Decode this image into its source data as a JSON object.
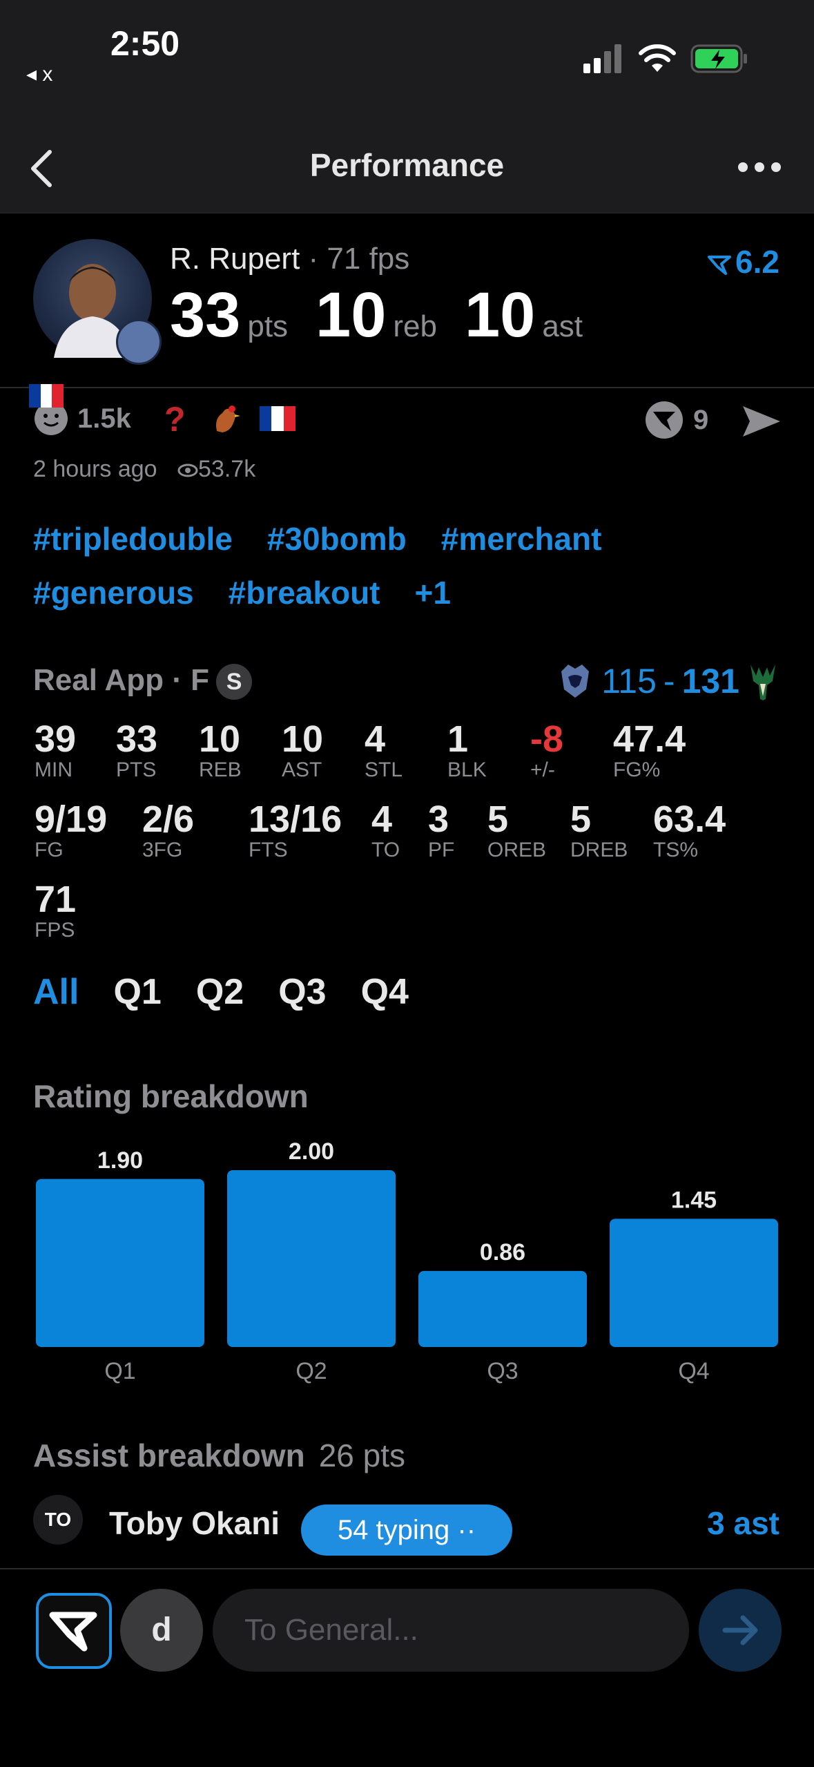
{
  "status": {
    "time": "2:50",
    "back_app": "◂ x"
  },
  "header": {
    "title": "Performance"
  },
  "player": {
    "name": "R. Rupert",
    "fps_label": " · 71 fps",
    "pts": "33",
    "pts_unit": "pts",
    "reb": "10",
    "reb_unit": "reb",
    "ast": "10",
    "ast_unit": "ast",
    "rating": "6.2"
  },
  "social": {
    "likes": "1.5k",
    "comments": "9",
    "time_ago": "2 hours ago",
    "views": "53.7k"
  },
  "tags": [
    "#tripledouble",
    "#30bomb",
    "#merchant",
    "#generous",
    "#breakout",
    "+1"
  ],
  "game": {
    "league": "Real App · F",
    "badge": "S",
    "score_home": "115",
    "score_sep": "-",
    "score_away": "131",
    "stats_row1": [
      {
        "v": "39",
        "l": "MIN"
      },
      {
        "v": "33",
        "l": "PTS"
      },
      {
        "v": "10",
        "l": "REB"
      },
      {
        "v": "10",
        "l": "AST"
      },
      {
        "v": "4",
        "l": "STL"
      },
      {
        "v": "1",
        "l": "BLK"
      },
      {
        "v": "-8",
        "l": "+/-"
      },
      {
        "v": "47.4",
        "l": "FG%"
      }
    ],
    "stats_row2": [
      {
        "v": "9/19",
        "l": "FG"
      },
      {
        "v": "2/6",
        "l": "3FG"
      },
      {
        "v": "13/16",
        "l": "FTS"
      },
      {
        "v": "4",
        "l": "TO"
      },
      {
        "v": "3",
        "l": "PF"
      },
      {
        "v": "5",
        "l": "OREB"
      },
      {
        "v": "5",
        "l": "DREB"
      },
      {
        "v": "63.4",
        "l": "TS%"
      }
    ],
    "stats_row3": [
      {
        "v": "71",
        "l": "FPS"
      }
    ]
  },
  "quarters": {
    "all": "All",
    "q1": "Q1",
    "q2": "Q2",
    "q3": "Q3",
    "q4": "Q4"
  },
  "rating_breakdown": {
    "title": "Rating breakdown"
  },
  "chart_data": {
    "type": "bar",
    "categories": [
      "Q1",
      "Q2",
      "Q3",
      "Q4"
    ],
    "values": [
      1.9,
      2.0,
      0.86,
      1.45
    ],
    "value_labels": [
      "1.90",
      "2.00",
      "0.86",
      "1.45"
    ],
    "ylim": [
      0,
      2.0
    ],
    "grid": false,
    "color": "#0a84d8"
  },
  "assist_breakdown": {
    "title": "Assist breakdown",
    "sub": "26 pts",
    "row": {
      "initials": "TO",
      "name": "Toby Okani",
      "value": "3 ast"
    },
    "typing": "54 typing ··"
  },
  "composer": {
    "avatar": "d",
    "placeholder": "To General..."
  },
  "colors": {
    "accent": "#1f8de0",
    "negative": "#e5383b",
    "muted": "#8e8e93"
  }
}
